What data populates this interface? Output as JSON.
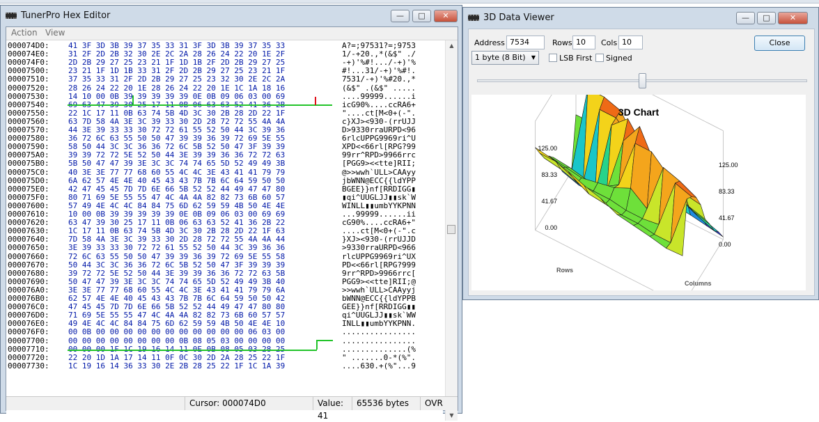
{
  "hex_editor": {
    "title": "TunerPro Hex Editor",
    "menu": [
      "Action",
      "View"
    ],
    "rows": [
      {
        "addr": "000074D0:",
        "hex": "41 3F 3D 3B 39 37 35 33 31 3F 3D 3B 39 37 35 33",
        "ascii": "A?=;97531?=;9753"
      },
      {
        "addr": "000074E0:",
        "hex": "31 2F 2D 2B 32 30 2E 2C 2A 28 26 24 22 20 1E 2F",
        "ascii": "1/-+20.,*(&$\" ./"
      },
      {
        "addr": "000074F0:",
        "hex": "2D 2B 29 27 25 23 21 1F 1D 1B 2F 2D 2B 29 27 25",
        "ascii": "-+)'%#!.../-+)'%"
      },
      {
        "addr": "00007500:",
        "hex": "23 21 1F 1D 1B 33 31 2F 2D 2B 29 27 25 23 21 1F",
        "ascii": "#!...31/-+)'%#!."
      },
      {
        "addr": "00007510:",
        "hex": "37 35 33 31 2F 2D 2B 29 27 25 23 32 30 2E 2C 2A",
        "ascii": "7531/-+)'%#20.,*"
      },
      {
        "addr": "00007520:",
        "hex": "28 26 24 22 20 1E 28 26 24 22 20 1E 1C 1A 18 16",
        "ascii": "(&$\" .(&$\" ....."
      },
      {
        "addr": "00007530:",
        "hex": "14 10 00 0B 39 39 39 39 39 0E 0B 09 06 03 00 69",
        "ascii": "....99999......i"
      },
      {
        "addr": "00007540:",
        "hex": "69 63 47 39 30 25 17 11 0B 06 63 63 52 41 36 2B",
        "ascii": "icG90%....ccRA6+"
      },
      {
        "addr": "00007550:",
        "hex": "22 1C 17 11 0B 63 74 5B 4D 3C 30 2B 28 2D 22 1F",
        "ascii": "\"....ct[M<0+(-\"."
      },
      {
        "addr": "00007560:",
        "hex": "63 7D 58 4A 3E 3C 39 33 30 2D 28 72 72 55 4A 4A",
        "ascii": "c}XJ><930-(rrUJJ"
      },
      {
        "addr": "00007570:",
        "hex": "44 3E 39 33 33 30 72 72 61 55 52 50 44 3C 39 36",
        "ascii": "D>9330rraURPD<96"
      },
      {
        "addr": "00007580:",
        "hex": "36 72 6C 63 55 50 50 47 39 39 36 39 72 69 5E 55",
        "ascii": "6rlcUPPG9969ri^U"
      },
      {
        "addr": "00007590:",
        "hex": "58 50 44 3C 3C 36 36 72 6C 5B 52 50 47 3F 39 39",
        "ascii": "XPD<<66rl[RPG?99"
      },
      {
        "addr": "000075A0:",
        "hex": "39 39 72 72 5E 52 50 44 3E 39 39 36 36 72 72 63",
        "ascii": "99rr^RPD>9966rrc"
      },
      {
        "addr": "000075B0:",
        "hex": "5B 50 47 47 39 3E 3C 3C 74 74 65 5D 52 49 49 3B",
        "ascii": "[PGG9><<tte]RII;"
      },
      {
        "addr": "000075C0:",
        "hex": "40 3E 3E 77 77 68 60 55 4C 4C 3E 43 41 41 79 79",
        "ascii": "@>>wwh`ULL>CAAyy"
      },
      {
        "addr": "000075D0:",
        "hex": "6A 62 57 4E 4E 40 45 43 43 7B 7B 6C 64 59 50 50",
        "ascii": "jbWNN@ECC{{ldYPP"
      },
      {
        "addr": "000075E0:",
        "hex": "42 47 45 45 7D 7D 6E 66 5B 52 52 44 49 47 47 80",
        "ascii": "BGEE}}nf[RRDIGG▮"
      },
      {
        "addr": "000075F0:",
        "hex": "80 71 69 5E 55 55 47 4C 4A 4A 82 82 73 6B 60 57",
        "ascii": "▮qi^UUGLJJ▮▮sk`W"
      },
      {
        "addr": "00007600:",
        "hex": "57 49 4E 4C 4C 84 84 75 6D 62 59 59 4B 50 4E 4E",
        "ascii": "WINLL▮▮umbYYKPNN"
      },
      {
        "addr": "00007610:",
        "hex": "10 00 0B 39 39 39 39 39 0E 0B 09 06 03 00 69 69",
        "ascii": "...99999......ii"
      },
      {
        "addr": "00007620:",
        "hex": "63 47 39 30 25 17 11 0B 06 63 63 52 41 36 2B 22",
        "ascii": "cG90%....ccRA6+\""
      },
      {
        "addr": "00007630:",
        "hex": "1C 17 11 0B 63 74 5B 4D 3C 30 2B 28 2D 22 1F 63",
        "ascii": "....ct[M<0+(-\".c"
      },
      {
        "addr": "00007640:",
        "hex": "7D 58 4A 3E 3C 39 33 30 2D 28 72 72 55 4A 4A 44",
        "ascii": "}XJ><930-(rrUJJD"
      },
      {
        "addr": "00007650:",
        "hex": "3E 39 33 33 30 72 72 61 55 52 50 44 3C 39 36 36",
        "ascii": ">9330rraURPD<966"
      },
      {
        "addr": "00007660:",
        "hex": "72 6C 63 55 50 50 47 39 39 36 39 72 69 5E 55 58",
        "ascii": "rlcUPPG9969ri^UX"
      },
      {
        "addr": "00007670:",
        "hex": "50 44 3C 3C 36 36 72 6C 5B 52 50 47 3F 39 39 39",
        "ascii": "PD<<66rl[RPG?999"
      },
      {
        "addr": "00007680:",
        "hex": "39 72 72 5E 52 50 44 3E 39 39 36 36 72 72 63 5B",
        "ascii": "9rr^RPD>9966rrc["
      },
      {
        "addr": "00007690:",
        "hex": "50 47 47 39 3E 3C 3C 74 74 65 5D 52 49 49 3B 40",
        "ascii": "PGG9><<tte]RII;@"
      },
      {
        "addr": "000076A0:",
        "hex": "3E 3E 77 77 68 60 55 4C 4C 3E 43 41 41 79 79 6A",
        "ascii": ">>wwh`ULL>CAAyyj"
      },
      {
        "addr": "000076B0:",
        "hex": "62 57 4E 4E 40 45 43 43 7B 7B 6C 64 59 50 50 42",
        "ascii": "bWNN@ECC{{ldYPPB"
      },
      {
        "addr": "000076C0:",
        "hex": "47 45 45 7D 7D 6E 66 5B 52 52 44 49 47 47 80 80",
        "ascii": "GEE}}nf[RRDIGG▮▮"
      },
      {
        "addr": "000076D0:",
        "hex": "71 69 5E 55 55 47 4C 4A 4A 82 82 73 6B 60 57 57",
        "ascii": "qi^UUGLJJ▮▮sk`WW"
      },
      {
        "addr": "000076E0:",
        "hex": "49 4E 4C 4C 84 84 75 6D 62 59 59 4B 50 4E 4E 10",
        "ascii": "INLL▮▮umbYYKPNN."
      },
      {
        "addr": "000076F0:",
        "hex": "00 0B 00 00 00 00 00 00 00 00 00 00 00 06 03 00",
        "ascii": "................"
      },
      {
        "addr": "00007700:",
        "hex": "00 00 00 00 00 00 00 00 0B 08 05 03 00 00 00 00",
        "ascii": "................"
      },
      {
        "addr": "00007710:",
        "hex": "00 00 00 1F 1C 19 16 14 11 0E 0B 08 05 03 28 25",
        "ascii": "..............(%"
      },
      {
        "addr": "00007720:",
        "hex": "22 20 1D 1A 17 14 11 0F 0C 30 2D 2A 28 25 22 1F",
        "ascii": "\" .......0-*(%\"."
      },
      {
        "addr": "00007730:",
        "hex": "1C 19 16 14 36 33 30 2E 2B 28 25 22 1F 1C 1A 39",
        "ascii": "....630.+(%\"...9"
      }
    ],
    "status": {
      "cursor": "Cursor: 000074D0",
      "value": "Value: 41",
      "size": "65536 bytes",
      "mode": "OVR"
    }
  },
  "data_viewer": {
    "title": "3D Data Viewer",
    "address_label": "Address",
    "address_value": "7534",
    "rows_label": "Rows",
    "rows_value": "10",
    "cols_label": "Cols",
    "cols_value": "10",
    "size_option": "1 byte (8 Bit)",
    "lsb_first_label": "LSB First",
    "signed_label": "Signed",
    "close_label": "Close",
    "slider_fraction": 0.5
  },
  "chart_data": {
    "type": "surface3d",
    "title": "3D Chart",
    "xlabel": "Rows",
    "ylabel": "Columns",
    "left_ticks": [
      "125.00",
      "83.33",
      "41.67",
      "0.00"
    ],
    "right_ticks": [
      "125.00",
      "83.33",
      "41.67",
      "0.00"
    ],
    "zlim": [
      0,
      125
    ],
    "grid": [
      [
        57,
        57,
        57,
        57,
        57,
        14,
        11,
        9,
        6,
        3
      ],
      [
        0,
        105,
        105,
        99,
        71,
        57,
        48,
        37,
        23,
        17
      ],
      [
        11,
        6,
        99,
        99,
        82,
        65,
        54,
        43,
        34,
        27
      ],
      [
        17,
        11,
        11,
        99,
        116,
        91,
        77,
        60,
        48,
        43
      ],
      [
        34,
        28,
        24,
        33,
        99,
        125,
        88,
        74,
        62,
        57
      ],
      [
        50,
        48,
        44,
        45,
        57,
        114,
        114,
        97,
        85,
        82
      ],
      [
        60,
        57,
        54,
        58,
        62,
        71,
        57,
        114,
        108,
        99
      ],
      [
        66,
        63,
        57,
        57,
        57,
        54,
        54,
        57,
        114,
        108
      ],
      [
        80,
        80,
        72,
        62,
        60,
        57,
        57,
        54,
        54,
        114
      ],
      [
        95,
        92,
        87,
        80,
        75,
        66,
        63,
        60,
        56,
        57
      ]
    ],
    "palette": [
      "#2c3bd8",
      "#1f8be0",
      "#19c6c9",
      "#27d38a",
      "#6ee03a",
      "#c9e52a",
      "#f3d31a",
      "#f4a51c",
      "#ef6a16",
      "#e1311a"
    ]
  }
}
